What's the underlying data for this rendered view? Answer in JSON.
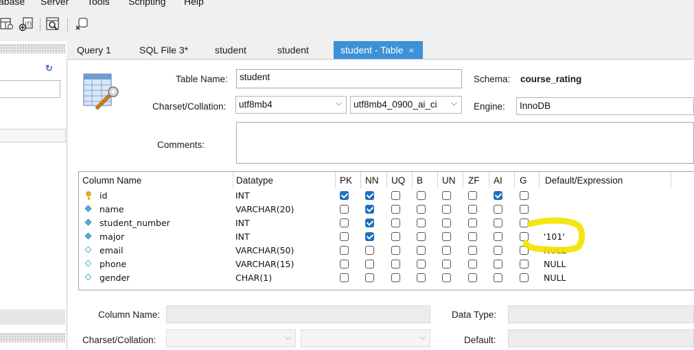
{
  "menu": [
    "abase",
    "Server",
    "Tools",
    "Scripting",
    "Help"
  ],
  "tabs": [
    {
      "label": "Query 1"
    },
    {
      "label": "SQL File 3*"
    },
    {
      "label": "student"
    },
    {
      "label": "student"
    },
    {
      "label": "student - Table",
      "active": true
    }
  ],
  "tab_close_glyph": "×",
  "refresh_glyph": "↻",
  "editor": {
    "table_name_label": "Table Name:",
    "table_name_value": "student",
    "schema_label": "Schema:",
    "schema_value": "course_rating",
    "charset_label": "Charset/Collation:",
    "charset_value": "utf8mb4",
    "collation_value": "utf8mb4_0900_ai_ci",
    "engine_label": "Engine:",
    "engine_value": "InnoDB",
    "comments_label": "Comments:"
  },
  "grid": {
    "headers": [
      "Column Name",
      "Datatype",
      "PK",
      "NN",
      "UQ",
      "B",
      "UN",
      "ZF",
      "AI",
      "G",
      "Default/Expression"
    ],
    "rows": [
      {
        "name": "id",
        "type": "INT",
        "icon": "primary-key",
        "flags": [
          true,
          true,
          false,
          false,
          false,
          false,
          true,
          false
        ],
        "default": ""
      },
      {
        "name": "name",
        "type": "VARCHAR(20)",
        "icon": "column-notnull",
        "flags": [
          false,
          true,
          false,
          false,
          false,
          false,
          false,
          false
        ],
        "default": ""
      },
      {
        "name": "student_number",
        "type": "INT",
        "icon": "column-notnull",
        "flags": [
          false,
          true,
          false,
          false,
          false,
          false,
          false,
          false
        ],
        "default": ""
      },
      {
        "name": "major",
        "type": "INT",
        "icon": "column-notnull",
        "flags": [
          false,
          true,
          false,
          false,
          false,
          false,
          false,
          false
        ],
        "default": "'101'"
      },
      {
        "name": "email",
        "type": "VARCHAR(50)",
        "icon": "column-nullable",
        "flags": [
          false,
          false,
          false,
          false,
          false,
          false,
          false,
          false
        ],
        "default": "NULL"
      },
      {
        "name": "phone",
        "type": "VARCHAR(15)",
        "icon": "column-nullable",
        "flags": [
          false,
          false,
          false,
          false,
          false,
          false,
          false,
          false
        ],
        "default": "NULL"
      },
      {
        "name": "gender",
        "type": "CHAR(1)",
        "icon": "column-nullable",
        "flags": [
          false,
          false,
          false,
          false,
          false,
          false,
          false,
          false
        ],
        "default": "NULL"
      }
    ]
  },
  "details": {
    "column_name_label": "Column Name:",
    "data_type_label": "Data Type:",
    "charset_label": "Charset/Collation:",
    "default_label": "Default:"
  },
  "colors": {
    "active_tab": "#3d91d6",
    "checkbox_on": "#1f6fbf",
    "highlight_annotation": "#f2e400"
  }
}
